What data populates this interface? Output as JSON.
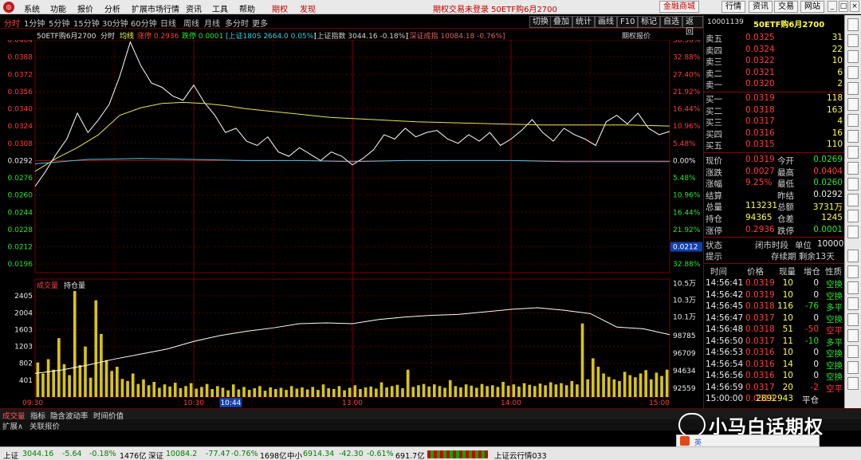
{
  "menubar": {
    "items": [
      "系统",
      "功能",
      "报价",
      "分析",
      "扩展市场行情",
      "资讯",
      "工具",
      "帮助"
    ],
    "options_tab": "期权",
    "discover_tab": "发现",
    "window_title": "期权交易未登录  50ETF购6月2700",
    "right_buttons": [
      "金融商城",
      "行情",
      "资讯",
      "交易",
      "网站"
    ],
    "win_controls": [
      "_",
      "□",
      "×"
    ]
  },
  "periodbar": {
    "periods": [
      "分时",
      "1分钟",
      "5分钟",
      "15分钟",
      "30分钟",
      "60分钟",
      "日线",
      "周线",
      "月线",
      "多分时",
      "更多"
    ],
    "active": "分时",
    "tools": [
      "切换",
      "叠加",
      "统计",
      "画线",
      "F10",
      "标记",
      "自选",
      "返回"
    ]
  },
  "inforow": {
    "name": "50ETF购6月2700",
    "mode": "分时",
    "avg_label": "均线",
    "limit_up": "涨停 0.2936",
    "limit_down": "跌停 0.0001",
    "sh180": "[上证180S 2664.0 0.05%]",
    "sh_index": "[上证指数 3044.16 -0.18%]",
    "sz_index": "[深证成指 10084.18 -0.76%]",
    "right_label": "期权报价"
  },
  "chart_data": {
    "type": "line",
    "title": "50ETF购6月2700",
    "price_axis": {
      "ticks": [
        "0.0404",
        "0.0388",
        "0.0372",
        "0.0356",
        "0.0340",
        "0.0324",
        "0.0308",
        "0.0292",
        "0.0276",
        "0.0260",
        "0.0244",
        "0.0228",
        "0.0212",
        "0.0196"
      ],
      "ylim": [
        0.0188,
        0.0404
      ],
      "prev_settle": 0.0292,
      "current_marker": "0.0212"
    },
    "pct_axis": {
      "ticks": [
        "38.36%",
        "32.88%",
        "27.40%",
        "21.92%",
        "16.44%",
        "10.96%",
        "5.48%",
        "0.00%",
        "5.48%",
        "10.96%",
        "16.44%",
        "21.92%",
        "27.40%",
        "32.88%"
      ]
    },
    "x_axis": {
      "labels": [
        "09:30",
        "10:30",
        "10:44",
        "13:00",
        "14:00",
        "15:00"
      ],
      "highlight": "10:44"
    },
    "series": [
      {
        "name": "价格",
        "color": "#ffffff",
        "x": [
          0,
          4,
          8,
          12,
          16,
          20,
          24,
          28,
          32,
          36,
          40,
          44,
          48,
          52,
          56,
          60,
          64,
          68,
          72,
          76,
          80,
          84,
          88,
          92,
          96,
          100,
          104,
          108,
          112,
          116,
          120,
          124,
          128,
          132,
          136,
          140,
          144,
          148,
          152,
          156,
          160,
          164,
          168,
          172,
          176,
          180,
          184,
          188,
          192,
          196,
          200,
          204,
          208,
          212,
          216,
          220,
          224,
          228,
          232,
          236,
          240
        ],
        "y": [
          0.0268,
          0.0282,
          0.0298,
          0.0312,
          0.0336,
          0.0318,
          0.033,
          0.0344,
          0.037,
          0.0402,
          0.038,
          0.0364,
          0.036,
          0.0352,
          0.0348,
          0.0362,
          0.0346,
          0.0334,
          0.0318,
          0.0322,
          0.031,
          0.0306,
          0.0314,
          0.03,
          0.0296,
          0.0304,
          0.0298,
          0.0292,
          0.03,
          0.0296,
          0.0288,
          0.0294,
          0.0302,
          0.0316,
          0.0312,
          0.0322,
          0.0314,
          0.0318,
          0.032,
          0.0312,
          0.0308,
          0.0316,
          0.031,
          0.0318,
          0.0306,
          0.0312,
          0.032,
          0.033,
          0.0318,
          0.031,
          0.0322,
          0.0316,
          0.0312,
          0.0306,
          0.0328,
          0.0334,
          0.0326,
          0.0336,
          0.0322,
          0.0316,
          0.0319
        ]
      },
      {
        "name": "均价",
        "color": "#e8e84a",
        "x": [
          0,
          8,
          16,
          24,
          32,
          40,
          48,
          56,
          64,
          72,
          80,
          96,
          112,
          128,
          144,
          160,
          176,
          192,
          208,
          224,
          240
        ],
        "y": [
          0.0282,
          0.0294,
          0.0304,
          0.0316,
          0.0334,
          0.0341,
          0.0345,
          0.0346,
          0.0345,
          0.0343,
          0.034,
          0.0336,
          0.0332,
          0.033,
          0.0328,
          0.0327,
          0.0326,
          0.0325,
          0.0325,
          0.0325,
          0.0324
        ]
      },
      {
        "name": "标的",
        "color": "#44c8e8",
        "x": [
          0,
          20,
          40,
          60,
          80,
          100,
          120,
          140,
          160,
          180,
          200,
          220,
          240
        ],
        "y": [
          0.0289,
          0.0293,
          0.0294,
          0.0293,
          0.0292,
          0.0292,
          0.0291,
          0.0292,
          0.0292,
          0.0292,
          0.0291,
          0.0291,
          0.0291
        ]
      }
    ],
    "volume_panel": {
      "title": "成交量",
      "title2": "持仓量",
      "vol_ticks": [
        "2405",
        "2004",
        "1603",
        "1203",
        "802",
        "401"
      ],
      "vol_ylim": [
        0,
        2806
      ],
      "oi_ticks": [
        "10.5万",
        "10.3万",
        "10.1万",
        "98785",
        "96709",
        "94634",
        "92559"
      ],
      "oi_ylim": [
        91500,
        105500
      ],
      "vol_x": [
        1,
        3,
        5,
        7,
        9,
        11,
        13,
        15,
        17,
        19,
        21,
        23,
        25,
        27,
        29,
        31,
        33,
        35,
        37,
        39,
        41,
        43,
        45,
        47,
        49,
        51,
        53,
        55,
        57,
        59,
        61,
        63,
        65,
        67,
        69,
        71,
        73,
        75,
        77,
        79,
        81,
        83,
        85,
        87,
        89,
        91,
        93,
        95,
        97,
        99,
        101,
        103,
        105,
        107,
        109,
        111,
        113,
        115,
        117,
        119,
        121,
        123,
        125,
        127,
        129,
        131,
        133,
        135,
        137,
        139,
        141,
        143,
        145,
        147,
        149,
        151,
        153,
        155,
        157,
        159,
        161,
        163,
        165,
        167,
        169,
        171,
        173,
        175,
        177,
        179,
        181,
        183,
        185,
        187,
        189,
        191,
        193,
        195,
        197,
        199,
        201,
        203,
        205,
        207,
        209,
        211,
        213,
        215,
        217,
        219,
        221,
        223,
        225,
        227,
        229,
        231,
        233,
        235,
        237,
        239
      ],
      "vol_values": [
        820,
        560,
        900,
        650,
        1400,
        780,
        520,
        2520,
        760,
        1200,
        460,
        2300,
        1500,
        880,
        620,
        720,
        430,
        380,
        560,
        310,
        420,
        280,
        360,
        220,
        300,
        250,
        340,
        210,
        260,
        330,
        200,
        240,
        310,
        190,
        260,
        220,
        160,
        300,
        180,
        240,
        170,
        210,
        260,
        150,
        230,
        190,
        220,
        170,
        260,
        200,
        230,
        180,
        240,
        170,
        300,
        210,
        190,
        260,
        160,
        220,
        280,
        190,
        230,
        250,
        200,
        350,
        230,
        260,
        290,
        210,
        650,
        240,
        280,
        310,
        250,
        300,
        260,
        220,
        400,
        260,
        230,
        300,
        270,
        220,
        310,
        260,
        280,
        240,
        360,
        270,
        300,
        250,
        330,
        290,
        260,
        320,
        280,
        350,
        300,
        330,
        280,
        380,
        300,
        1750,
        420,
        920,
        720,
        560,
        480,
        420,
        380,
        600,
        520,
        470,
        560,
        640,
        420,
        580,
        500,
        650
      ],
      "oi_x": [
        0,
        10,
        20,
        30,
        40,
        50,
        60,
        70,
        80,
        90,
        100,
        110,
        120,
        130,
        140,
        150,
        160,
        170,
        180,
        190,
        200,
        210,
        220,
        230,
        240
      ],
      "oi_values": [
        94300,
        94700,
        95300,
        96000,
        96600,
        97200,
        98100,
        98800,
        99300,
        99700,
        100200,
        100300,
        100200,
        100700,
        101000,
        101200,
        101300,
        101600,
        101900,
        102100,
        101800,
        101400,
        99800,
        99600,
        98900
      ]
    }
  },
  "quote": {
    "code": "10001139",
    "name": "50ETF购6月2700",
    "asks": [
      {
        "label": "卖五",
        "price": "0.0325",
        "vol": "31"
      },
      {
        "label": "卖四",
        "price": "0.0324",
        "vol": "22"
      },
      {
        "label": "卖三",
        "price": "0.0322",
        "vol": "10"
      },
      {
        "label": "卖二",
        "price": "0.0321",
        "vol": "6"
      },
      {
        "label": "卖一",
        "price": "0.0320",
        "vol": "2"
      }
    ],
    "bids": [
      {
        "label": "买一",
        "price": "0.0319",
        "vol": "118"
      },
      {
        "label": "买二",
        "price": "0.0318",
        "vol": "163"
      },
      {
        "label": "买三",
        "price": "0.0317",
        "vol": "4"
      },
      {
        "label": "买四",
        "price": "0.0316",
        "vol": "16"
      },
      {
        "label": "买五",
        "price": "0.0315",
        "vol": "110"
      }
    ],
    "stats": [
      {
        "l1": "现价",
        "v1": "0.0319",
        "c1": "red",
        "l2": "今开",
        "v2": "0.0269",
        "c2": "green"
      },
      {
        "l1": "涨跌",
        "v1": "0.0027",
        "c1": "red",
        "l2": "最高",
        "v2": "0.0404",
        "c2": "red"
      },
      {
        "l1": "涨幅",
        "v1": "9.25%",
        "c1": "red",
        "l2": "最低",
        "v2": "0.0260",
        "c2": "green"
      },
      {
        "l1": "结算",
        "v1": "",
        "c1": "white",
        "l2": "昨结",
        "v2": "0.0292",
        "c2": "white"
      },
      {
        "l1": "总量",
        "v1": "113231",
        "c1": "yellow",
        "l2": "总额",
        "v2": "3731万",
        "c2": "yellow"
      },
      {
        "l1": "持仓",
        "v1": "94365",
        "c1": "yellow",
        "l2": "仓差",
        "v2": "1245",
        "c2": "yellow"
      },
      {
        "l1": "涨停",
        "v1": "0.2936",
        "c1": "red",
        "l2": "跌停",
        "v2": "0.0001",
        "c2": "green"
      }
    ],
    "state": {
      "label": "状态",
      "value": "闭市时段",
      "unit_label": "单位",
      "unit": "10000"
    },
    "hint": {
      "label": "提示",
      "value": "存续期 剩余13天"
    },
    "ticks_header": [
      "时间",
      "价格",
      "现量",
      "增仓",
      "性质"
    ],
    "ticks": [
      {
        "t": "14:56:41",
        "p": "0.0319",
        "pc": "red",
        "v": "10",
        "d": "0",
        "dc": "white",
        "n": "空换",
        "nc": "green"
      },
      {
        "t": "14:56:42",
        "p": "0.0319",
        "pc": "red",
        "v": "10",
        "d": "0",
        "dc": "white",
        "n": "空换",
        "nc": "green"
      },
      {
        "t": "14:56:45",
        "p": "0.0318",
        "pc": "red",
        "v": "116",
        "d": "-76",
        "dc": "green",
        "n": "多平",
        "nc": "green"
      },
      {
        "t": "14:56:47",
        "p": "0.0317",
        "pc": "red",
        "v": "10",
        "d": "0",
        "dc": "white",
        "n": "空换",
        "nc": "green"
      },
      {
        "t": "14:56:48",
        "p": "0.0318",
        "pc": "red",
        "v": "51",
        "d": "-50",
        "dc": "red",
        "n": "空平",
        "nc": "red"
      },
      {
        "t": "14:56:50",
        "p": "0.0317",
        "pc": "red",
        "v": "11",
        "d": "-10",
        "dc": "green",
        "n": "多平",
        "nc": "green"
      },
      {
        "t": "14:56:53",
        "p": "0.0316",
        "pc": "red",
        "v": "10",
        "d": "0",
        "dc": "white",
        "n": "空换",
        "nc": "green"
      },
      {
        "t": "14:56:54",
        "p": "0.0316",
        "pc": "red",
        "v": "14",
        "d": "0",
        "dc": "white",
        "n": "空换",
        "nc": "green"
      },
      {
        "t": "14:56:56",
        "p": "0.0316",
        "pc": "red",
        "v": "10",
        "d": "0",
        "dc": "white",
        "n": "空换",
        "nc": "green"
      },
      {
        "t": "14:56:59",
        "p": "0.0317",
        "pc": "red",
        "v": "20",
        "d": "-2",
        "dc": "red",
        "n": "空平",
        "nc": "red"
      },
      {
        "t": "15:00:00",
        "p": "0.0319",
        "pc": "red",
        "v": "2892943",
        "d": "平仓",
        "dc": "white",
        "n": "",
        "nc": "white"
      }
    ]
  },
  "bottom_tabs": [
    "成交量",
    "指标",
    "隐含波动率",
    "时间价值"
  ],
  "bottom_tabs2": [
    "扩展∧",
    "关联报价"
  ],
  "status": {
    "sh": "上证",
    "sh_val": "3044.16",
    "sh_chg": "-5.64",
    "sh_pct": "-0.18%",
    "sh_amt": "1476亿",
    "sz": "深证",
    "sz_val": "10084.2",
    "sz_chg": "-77.47",
    "sz_pct": "-0.76%",
    "sz_amt": "1698亿",
    "zx": "中小",
    "zx_val": "6914.34",
    "zx_chg": "-42.30",
    "zx_pct": "-0.61%",
    "zx_amt": "691.7亿",
    "cloud": "上证云行情033"
  },
  "watermark": {
    "text": "小马白话期权"
  },
  "ime": {
    "label": "英"
  }
}
